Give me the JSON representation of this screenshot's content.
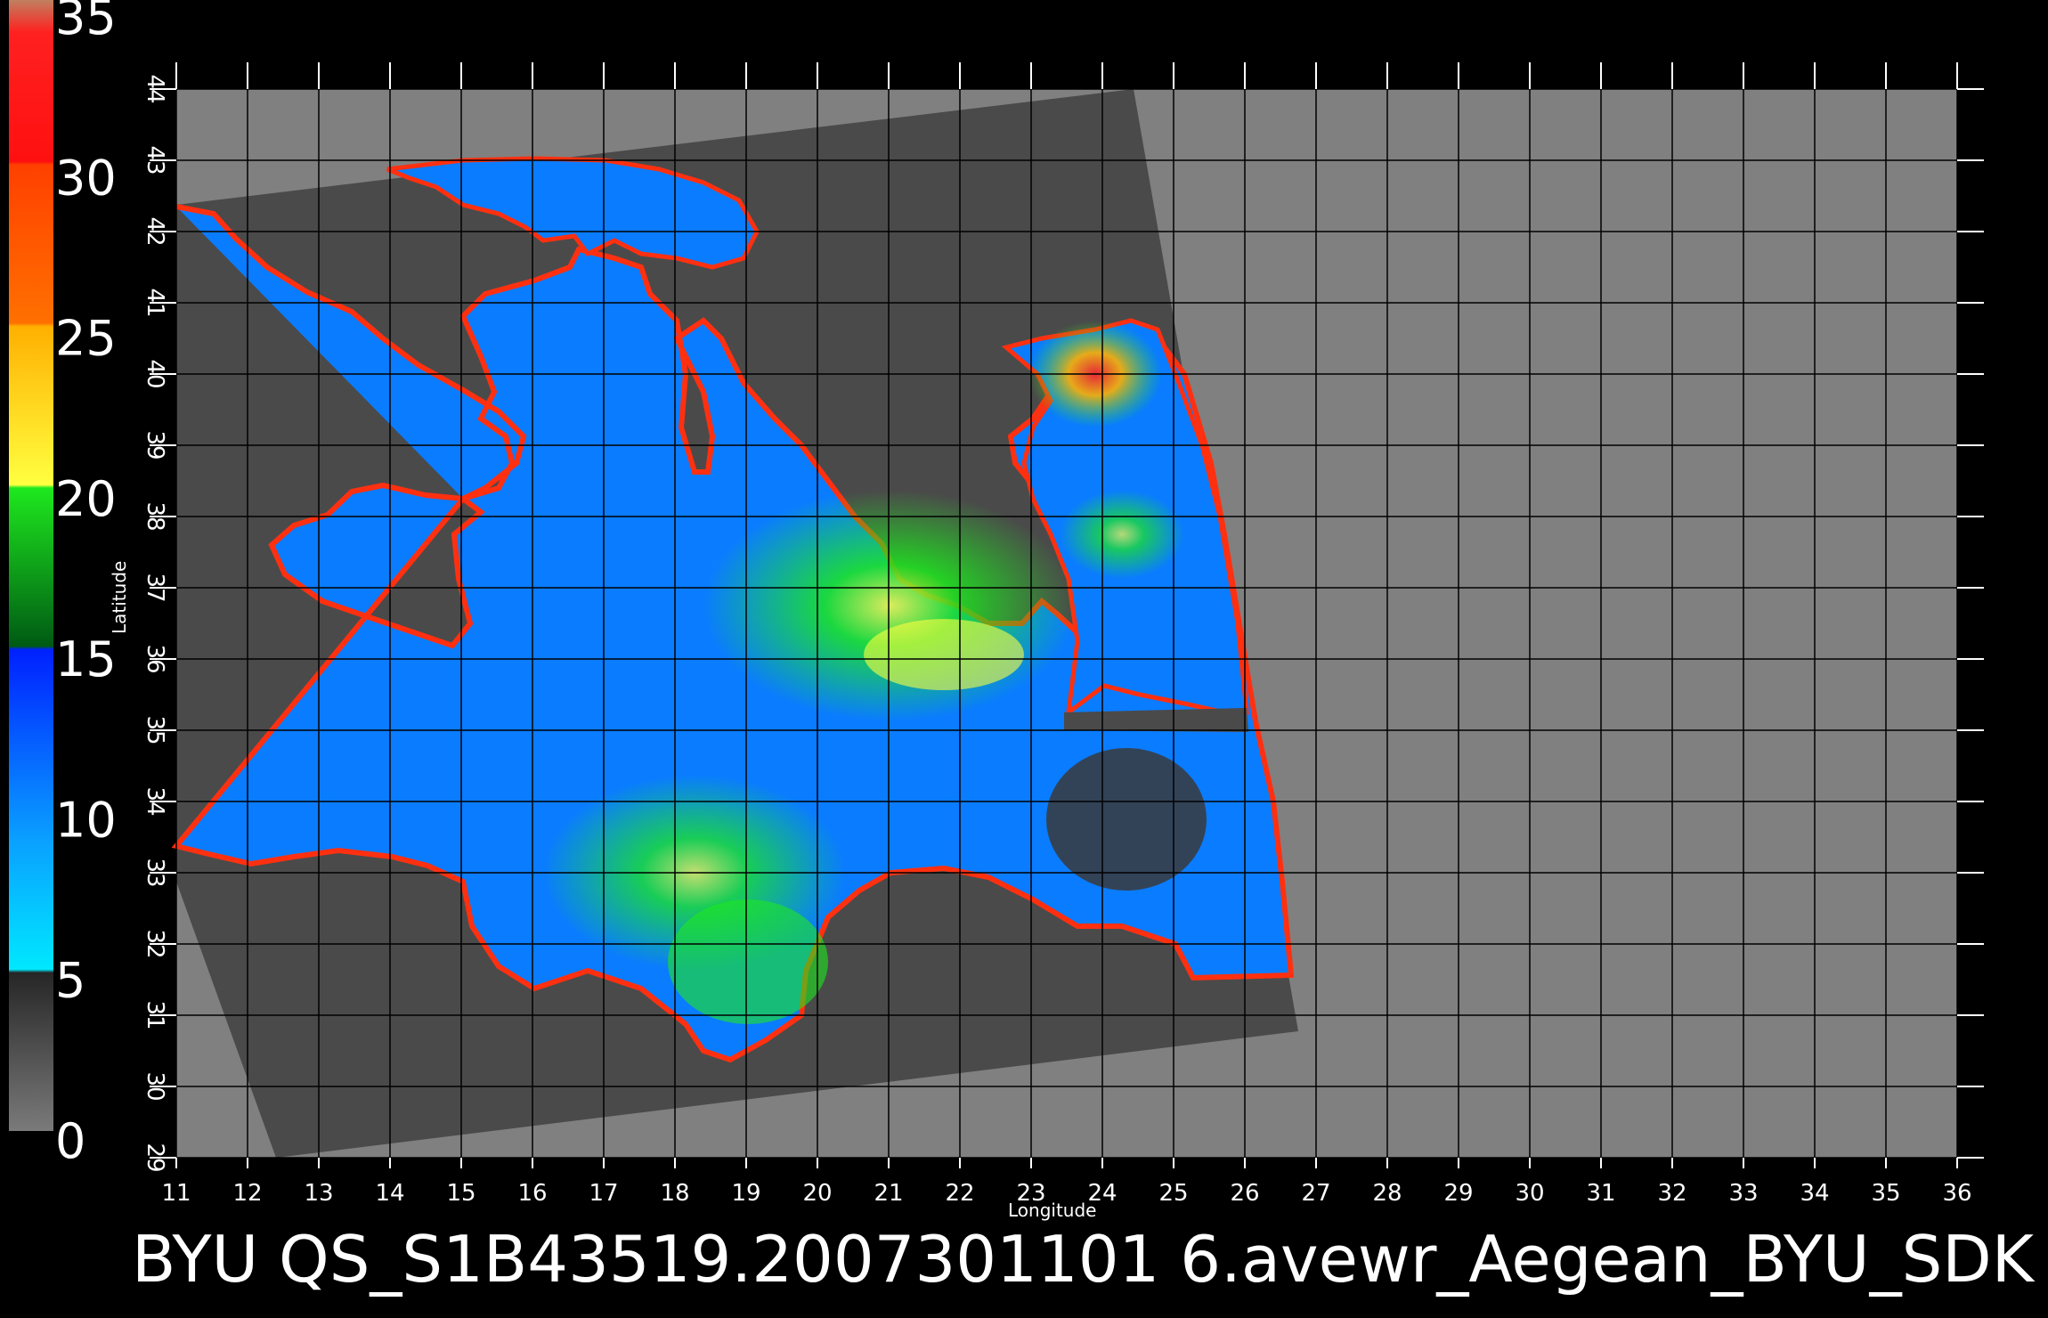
{
  "image_title": "BYU  QS_S1B43519.2007301101 6.avewr_Aegean_BYU_SDK",
  "axes": {
    "x_title": "Longitude",
    "y_title": "Latitude",
    "x_ticks": [
      "11",
      "12",
      "13",
      "14",
      "15",
      "16",
      "17",
      "18",
      "19",
      "20",
      "21",
      "22",
      "23",
      "24",
      "25",
      "26",
      "27",
      "28",
      "29",
      "30",
      "31",
      "32",
      "33",
      "34",
      "35",
      "36"
    ],
    "y_ticks": [
      "29",
      "30",
      "31",
      "32",
      "33",
      "34",
      "35",
      "36",
      "37",
      "38",
      "39",
      "40",
      "41",
      "42",
      "43",
      "44"
    ],
    "x_range": [
      11,
      36
    ],
    "y_range": [
      29,
      44
    ]
  },
  "colorbar": {
    "labels": [
      "0",
      "5",
      "10",
      "15",
      "20",
      "25",
      "30",
      "35"
    ],
    "range": [
      0,
      35
    ],
    "stops": [
      {
        "value": 0,
        "color": "#7a7a7a"
      },
      {
        "value": 4.9,
        "color": "#262626"
      },
      {
        "value": 5,
        "color": "#00e8ff"
      },
      {
        "value": 9,
        "color": "#0aa0ff"
      },
      {
        "value": 14.9,
        "color": "#0020ff"
      },
      {
        "value": 15,
        "color": "#005a14"
      },
      {
        "value": 19.9,
        "color": "#1ee81e"
      },
      {
        "value": 20,
        "color": "#ffff40"
      },
      {
        "value": 24.9,
        "color": "#ffb000"
      },
      {
        "value": 25,
        "color": "#ff7000"
      },
      {
        "value": 29.9,
        "color": "#ff4000"
      },
      {
        "value": 30,
        "color": "#ff1010"
      },
      {
        "value": 34,
        "color": "#ff2020"
      },
      {
        "value": 35,
        "color": "#c08060"
      }
    ]
  },
  "colors": {
    "background": "#000000",
    "plot_bg": "#808080",
    "swath": "#4a4a4a",
    "land": "#555555",
    "grid": "#000000",
    "text": "#ffffff"
  }
}
